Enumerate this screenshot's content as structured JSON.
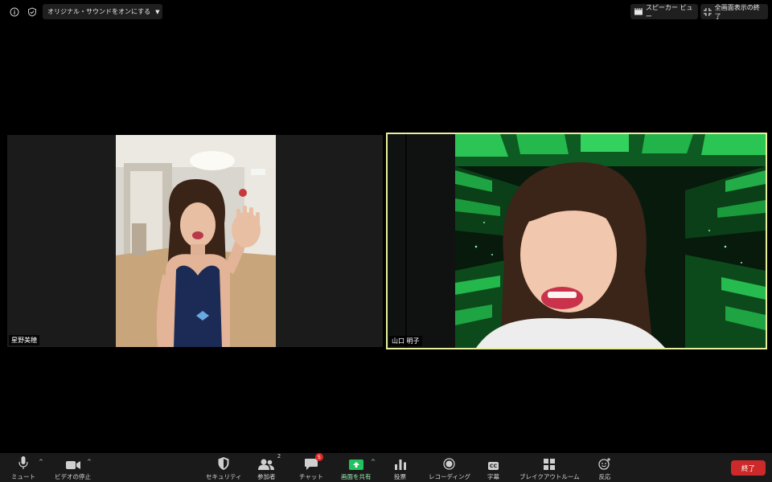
{
  "topbar": {
    "info_icon": "info-icon",
    "security_icon": "shield-check-icon",
    "original_sound_label": "オリジナル・サウンドをオンにする",
    "speaker_view_label": "スピーカー ビュー",
    "exit_fullscreen_label": "全画面表示の終了"
  },
  "participants": [
    {
      "name": "星野美穂",
      "active_speaker": false
    },
    {
      "name": "山口 明子",
      "active_speaker": true
    }
  ],
  "toolbar": {
    "mute_label": "ミュート",
    "video_label": "ビデオの停止",
    "security_label": "セキュリティ",
    "participants_label": "参加者",
    "participants_count": "2",
    "chat_label": "チャット",
    "chat_badge": "5",
    "share_label": "画面を共有",
    "polls_label": "投票",
    "record_label": "レコーディング",
    "captions_label": "字幕",
    "captions_icon_text": "CC",
    "breakout_label": "ブレイクアウトルーム",
    "reactions_label": "反応",
    "end_label": "終了"
  },
  "colors": {
    "active_speaker_border": "#e9ef9a",
    "share_green": "#22c35e",
    "end_red": "#cc2a2a",
    "badge_red": "#e02828"
  }
}
